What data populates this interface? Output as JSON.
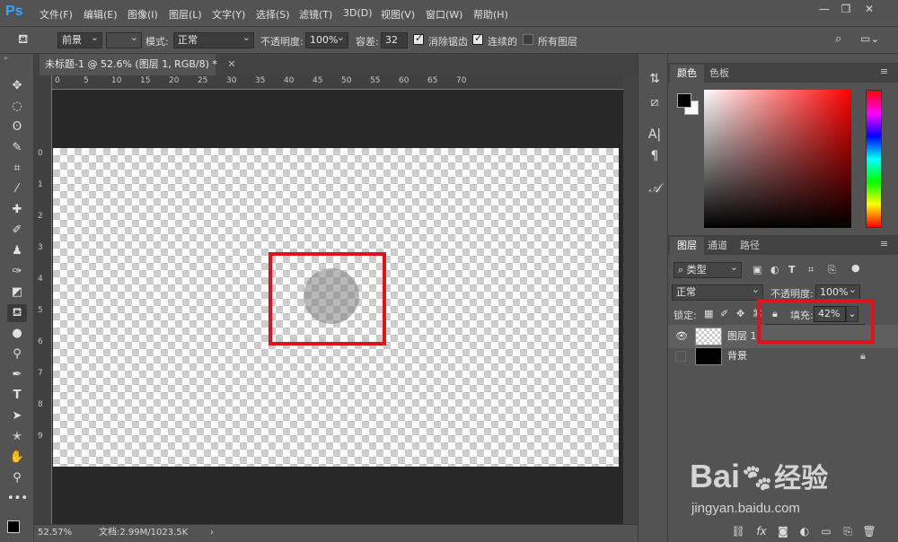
{
  "app": {
    "logo": "Ps"
  },
  "menu": [
    "文件(F)",
    "编辑(E)",
    "图像(I)",
    "图层(L)",
    "文字(Y)",
    "选择(S)",
    "滤镜(T)",
    "3D(D)",
    "视图(V)",
    "窗口(W)",
    "帮助(H)"
  ],
  "options": {
    "fill_source": "前景",
    "mode_label": "模式:",
    "mode_value": "正常",
    "opacity_label": "不透明度:",
    "opacity_value": "100%",
    "tolerance_label": "容差:",
    "tolerance_value": "32",
    "antialias_label": "消除锯齿",
    "contiguous_label": "连续的",
    "all_layers_label": "所有图层",
    "antialias_checked": true,
    "contiguous_checked": true,
    "all_layers_checked": false
  },
  "document": {
    "tab_title": "未标题-1 @ 52.6% (图层 1, RGB/8) *",
    "ruler_h": [
      "0",
      "5",
      "10",
      "15",
      "20",
      "25",
      "30",
      "35",
      "40",
      "45",
      "50",
      "55",
      "60",
      "65",
      "70"
    ],
    "ruler_v": [
      "0",
      "1",
      "2",
      "3",
      "4",
      "5",
      "6",
      "7",
      "8",
      "9"
    ]
  },
  "status": {
    "zoom": "52.57%",
    "doc_info": "文档:2.99M/1023.5K"
  },
  "color_panel": {
    "tab_color": "颜色",
    "tab_swatches": "色板",
    "foreground": "#000000",
    "background": "#ffffff"
  },
  "layers_panel": {
    "tab_layers": "图层",
    "tab_channels": "通道",
    "tab_paths": "路径",
    "filter_kind": "类型",
    "blend_mode": "正常",
    "opacity_label": "不透明度:",
    "opacity_value": "100%",
    "lock_label": "锁定:",
    "fill_label": "填充:",
    "fill_value": "42%",
    "fill_slider_value": 0.42,
    "layers": [
      {
        "name": "图层 1",
        "visible": true
      },
      {
        "name": "背景",
        "visible": false,
        "locked": true
      }
    ]
  },
  "watermark": {
    "brand": "Bai",
    "brand2": "经验",
    "url": "jingyan.baidu.com"
  }
}
